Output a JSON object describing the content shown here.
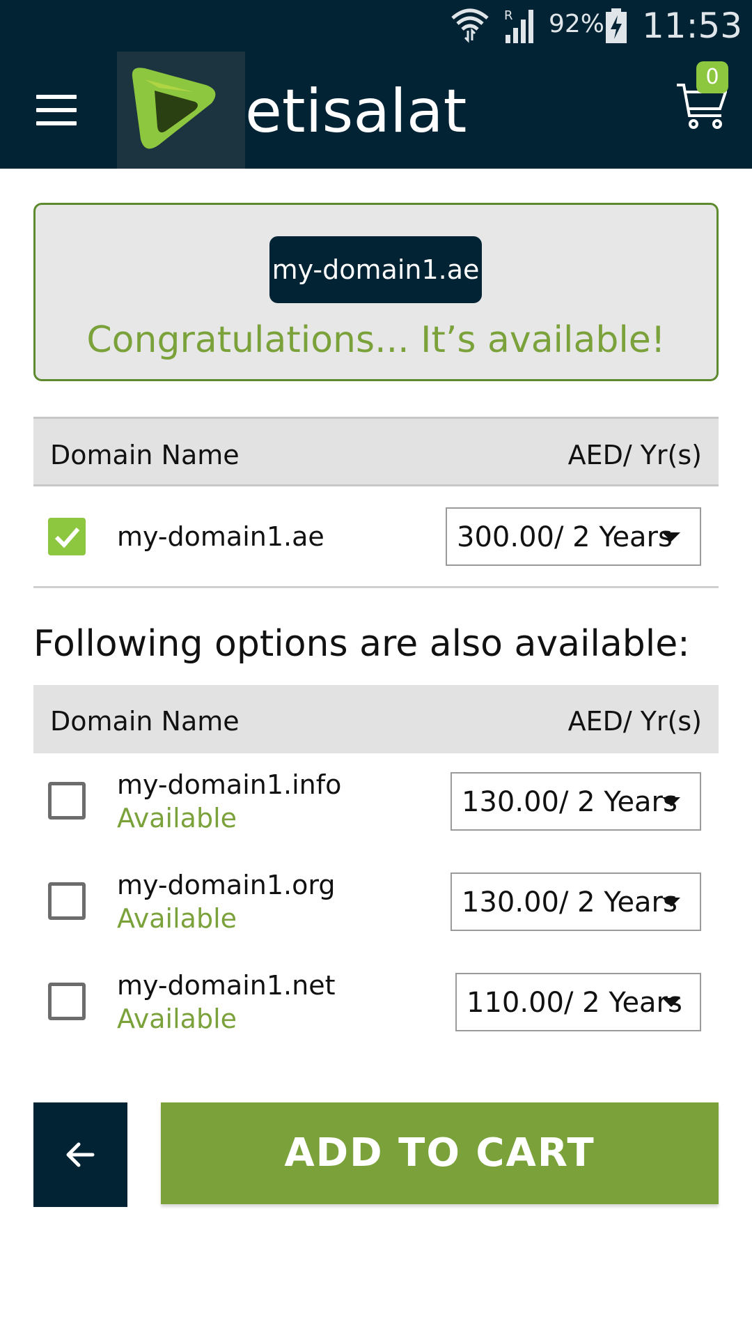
{
  "status_bar": {
    "battery_percent": "92%",
    "time": "11:53",
    "signal_roaming": "R"
  },
  "app_bar": {
    "brand": "etisalat",
    "cart_count": "0"
  },
  "availability": {
    "domain": "my-domain1.ae",
    "message": "Congratulations... It’s available!"
  },
  "table_header": {
    "col_domain": "Domain Name",
    "col_price": "AED/ Yr(s)"
  },
  "selected_domain": {
    "name": "my-domain1.ae",
    "price": "300.00/ 2 Years",
    "checked": true
  },
  "alternatives_title": "Following options are also available:",
  "alternatives_header": {
    "col_domain": "Domain Name",
    "col_price": "AED/ Yr(s)"
  },
  "alternatives": [
    {
      "name": "my-domain1.info",
      "status": "Available",
      "price": "130.00/ 2 Years",
      "checked": false
    },
    {
      "name": "my-domain1.org",
      "status": "Available",
      "price": "130.00/ 2 Years",
      "checked": false
    },
    {
      "name": "my-domain1.net",
      "status": "Available",
      "price": "110.00/ 2 Years",
      "checked": false
    }
  ],
  "buttons": {
    "add_to_cart": "ADD TO CART"
  },
  "colors": {
    "header_bg": "#022334",
    "accent_green": "#7ba23a",
    "check_green": "#8dc63f"
  }
}
